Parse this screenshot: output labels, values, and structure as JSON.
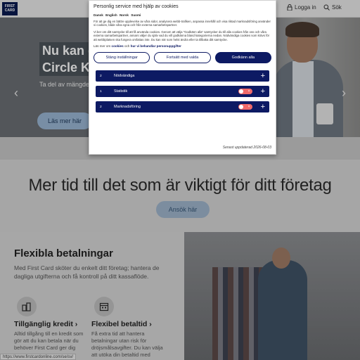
{
  "header": {
    "logo_line1": "FIRST",
    "logo_line2": "CARD",
    "login_label": "Logga in",
    "search_label": "Sök",
    "login_icon": "lock-icon",
    "search_icon": "search-icon"
  },
  "hero": {
    "title_line1": "Nu kan d",
    "title_line2": "Circle K:s",
    "subtitle": "Ta del av mängder",
    "cta_label": "Läs mer här",
    "prev_arrow": "‹",
    "next_arrow": "›"
  },
  "middle": {
    "heading": "Mer tid till det som är viktigt för ditt företag",
    "cta_label": "Ansök här"
  },
  "section": {
    "title": "Flexibla betalningar",
    "body": "Med First Card sköter du enkelt ditt företag; hantera de dagliga utgifterna och få kontroll på ditt kassaflöde.",
    "features": [
      {
        "icon": "coins-icon",
        "title": "Tillgänglig kredit ›",
        "text": "Alltid tillgång till en kredit som gör att du kan betala när du behöver First Card ger dig"
      },
      {
        "icon": "calendar-icon",
        "title": "Flexibel betaltid ›",
        "text": "Få extra tid att hantera betalningar utan risk för dröjsmålsavgifter. Du kan välja att utöka din betaltid med"
      }
    ]
  },
  "statusbar": {
    "url": "https://www.firstcardonline.com/se/sv/"
  },
  "cookie_dialog": {
    "title": "Personlig service med hjälp av cookies",
    "languages": [
      "Dansk",
      "English",
      "Norsk",
      "Suomi"
    ],
    "paragraph1": "För att ge dig en bättre upplevelse av våra sidor, analysera webb-trafiken, anpassa innehåll och visa riktad marknadsföring använder vi cookies, både våra egna och från externa samarbetspartner.",
    "paragraph2": "Vi ber om ditt samtycke till att få använda cookies. Genom att välja \"Godkänn alla\" samtycker du till alla cookies från oss och våra externa samarbetspartner, annars väljer du själv vad du vill godkänna bland kategorierna nedan. Nödvändiga cookies som krävs för att webbplatsen ska fungera omfattas inte. Du kan när som helst ändra eller ta tillbaka ditt samtycke.",
    "links_prefix": "Läs mer om",
    "link_cookies": "cookies",
    "links_mid": "och",
    "link_privacy": "hur vi behandlar personuppgifter",
    "btn_close": "Stäng inställningar",
    "btn_continue": "Fortsätt med valda",
    "btn_accept": "Godkänn alla",
    "categories": [
      {
        "num": "2",
        "label": "Nödvändiga",
        "has_toggle": false
      },
      {
        "num": "1",
        "label": "Statistik",
        "has_toggle": true,
        "toggle_on": false
      },
      {
        "num": "2",
        "label": "Marknadsföring",
        "has_toggle": true,
        "toggle_on": false
      }
    ],
    "updated": "Senast uppdaterad 2026-08-03",
    "toggle_off_color": "#f06a6a",
    "accent_color": "#0d1a63"
  }
}
